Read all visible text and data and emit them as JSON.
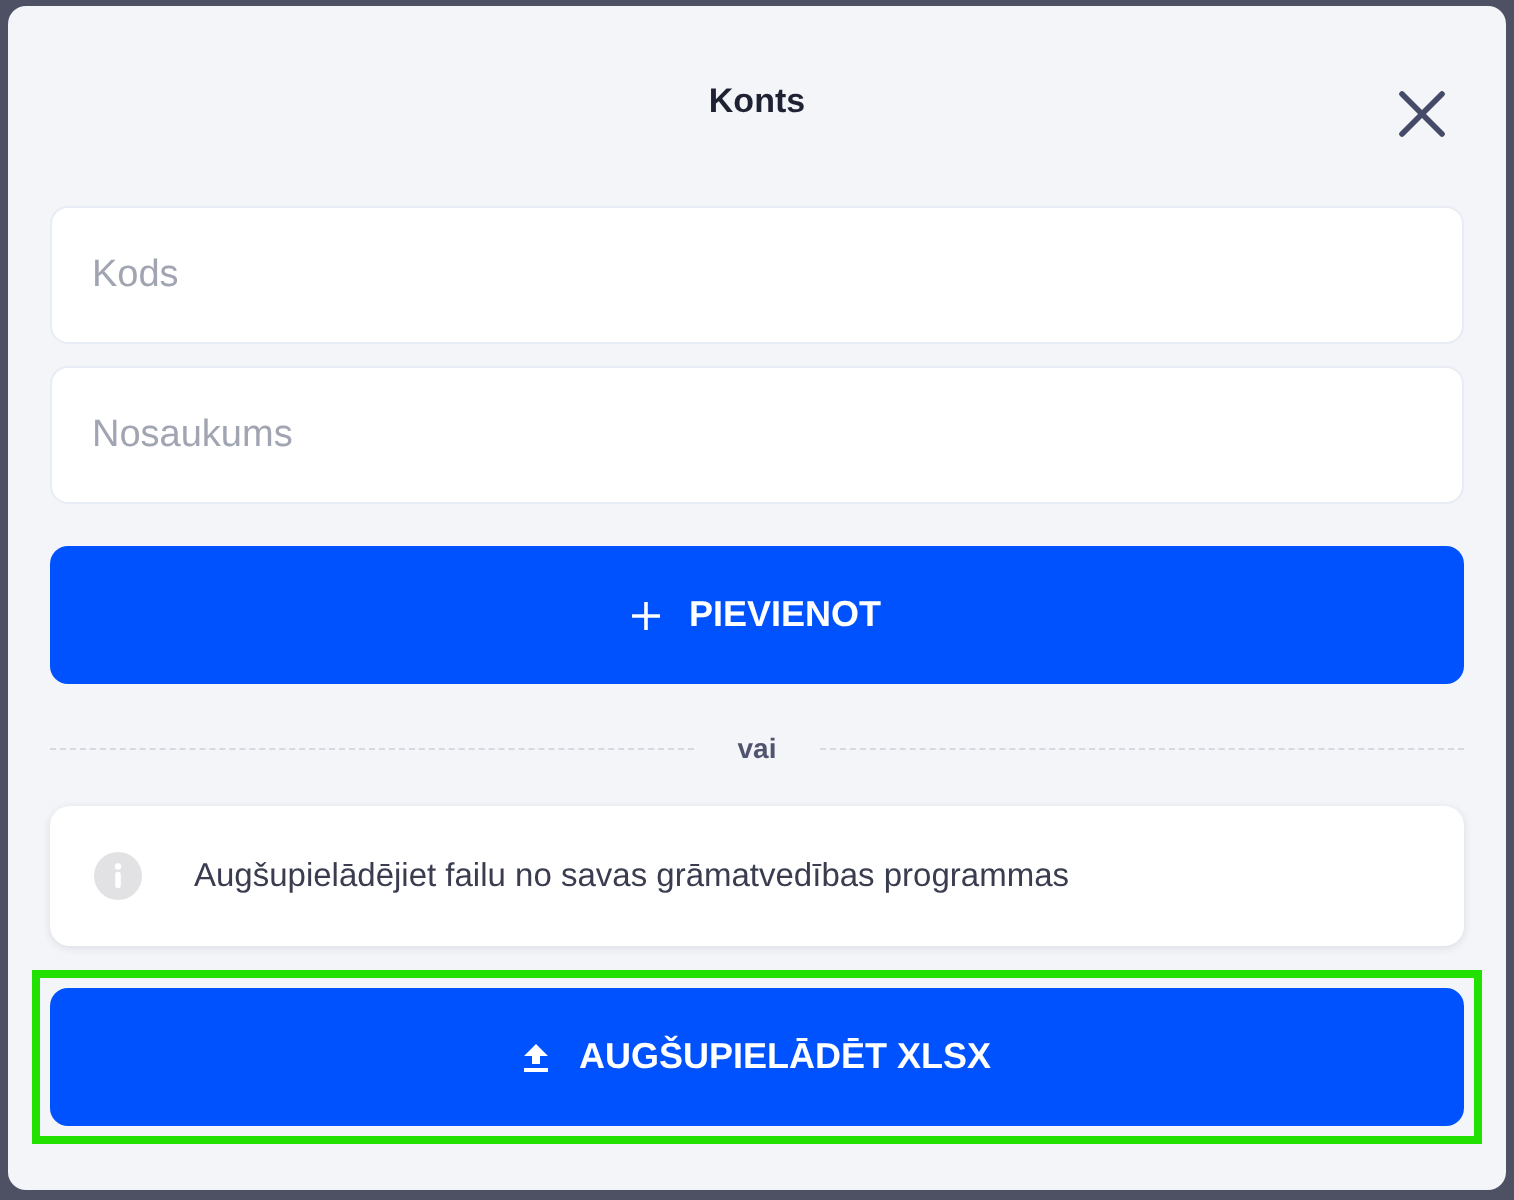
{
  "dialog": {
    "title": "Konts"
  },
  "fields": [
    {
      "placeholder": "Kods"
    },
    {
      "placeholder": "Nosaukums"
    }
  ],
  "add_button": {
    "label": "PIEVIENOT"
  },
  "divider": {
    "label": "vai"
  },
  "info_note": {
    "text": "Augšupielādējiet failu no savas grāmatvedības programmas"
  },
  "upload_button": {
    "label": "AUGŠUPIELĀDĒT XLSX",
    "highlighted": true
  }
}
